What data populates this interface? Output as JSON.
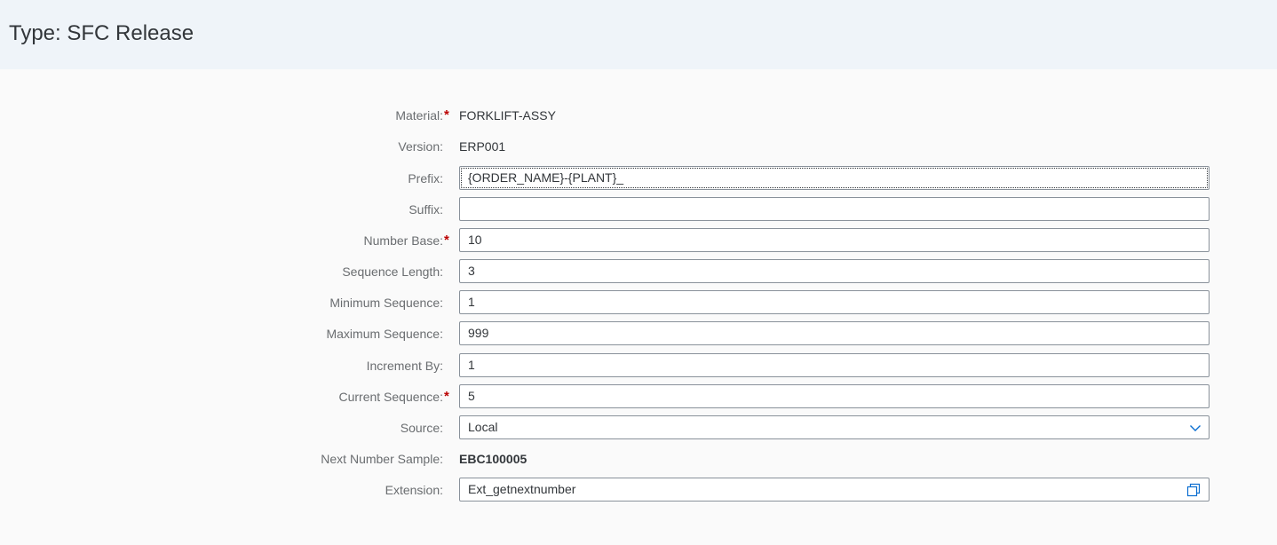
{
  "header": {
    "title": "Type: SFC Release"
  },
  "colors": {
    "header_bg": "#eff4f9",
    "label": "#6a6d70",
    "required": "#bb0000",
    "icon": "#0a6ed1"
  },
  "form": {
    "material": {
      "label": "Material:",
      "required_mark": "*",
      "value": "FORKLIFT-ASSY"
    },
    "version": {
      "label": "Version:",
      "value": "ERP001"
    },
    "prefix": {
      "label": "Prefix:",
      "value": "{ORDER_NAME}-{PLANT}_"
    },
    "suffix": {
      "label": "Suffix:",
      "value": ""
    },
    "number_base": {
      "label": "Number Base:",
      "required_mark": "*",
      "value": "10"
    },
    "sequence_length": {
      "label": "Sequence Length:",
      "value": "3"
    },
    "minimum_sequence": {
      "label": "Minimum Sequence:",
      "value": "1"
    },
    "maximum_sequence": {
      "label": "Maximum Sequence:",
      "value": "999"
    },
    "increment_by": {
      "label": "Increment By:",
      "value": "1"
    },
    "current_sequence": {
      "label": "Current Sequence:",
      "required_mark": "*",
      "value": "5"
    },
    "source": {
      "label": "Source:",
      "value": "Local",
      "icon": "chevron-down-icon"
    },
    "next_number_sample": {
      "label": "Next Number Sample:",
      "value": "EBC100005"
    },
    "extension": {
      "label": "Extension:",
      "value": "Ext_getnextnumber",
      "icon": "value-help-icon"
    }
  }
}
